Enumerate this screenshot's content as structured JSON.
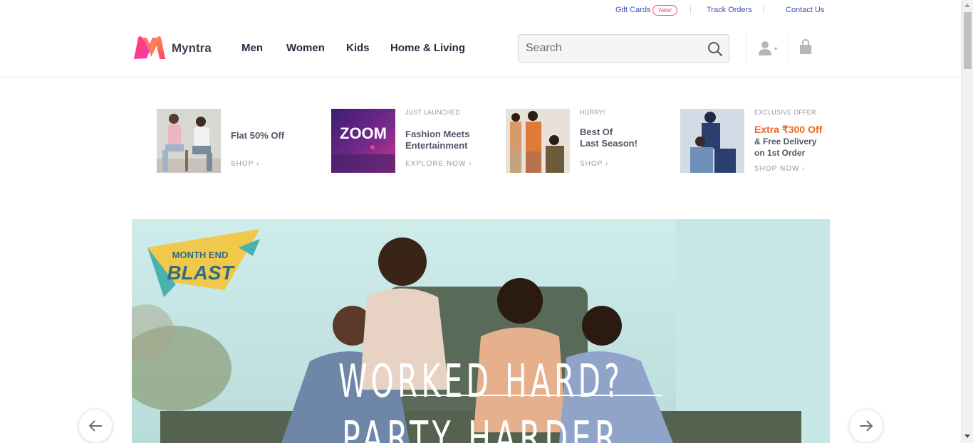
{
  "utility": {
    "gift_cards": "Gift Cards",
    "new_badge": "New",
    "track_orders": "Track Orders",
    "contact_us": "Contact Us"
  },
  "header": {
    "brand": "Myntra",
    "nav": [
      "Men",
      "Women",
      "Kids",
      "Home & Living"
    ],
    "search_placeholder": "Search"
  },
  "promos": [
    {
      "kicker": "",
      "title_line1": "Flat 50% Off",
      "title_line2": "",
      "cta": "SHOP"
    },
    {
      "kicker": "JUST LAUNCHED",
      "title_line1": "Fashion Meets",
      "title_line2": "Entertainment",
      "cta": "EXPLORE NOW",
      "thumb_text": "ZOOM"
    },
    {
      "kicker": "HURRY!",
      "title_line1": "Best Of",
      "title_line2": "Last Season!",
      "cta": "SHOP"
    },
    {
      "kicker": "EXCLUSIVE OFFER",
      "offer": "Extra ₹300 Off",
      "title_line1": "& Free Delivery",
      "title_line2": "on 1st Order",
      "cta": "SHOP NOW"
    }
  ],
  "hero": {
    "badge_line1": "MONTH END",
    "badge_line2": "BLAST",
    "headline": "WORKED HARD?",
    "subheadline": "PARTY HARDER"
  },
  "colors": {
    "accent_pink": "#ff3f6c",
    "link_blue": "#3e4fb1",
    "offer_orange": "#f16524",
    "text_dark": "#282c3f"
  },
  "icons": {
    "search": "search-icon",
    "profile": "profile-icon",
    "bag": "bag-icon",
    "prev": "arrow-left-icon",
    "next": "arrow-right-icon"
  }
}
